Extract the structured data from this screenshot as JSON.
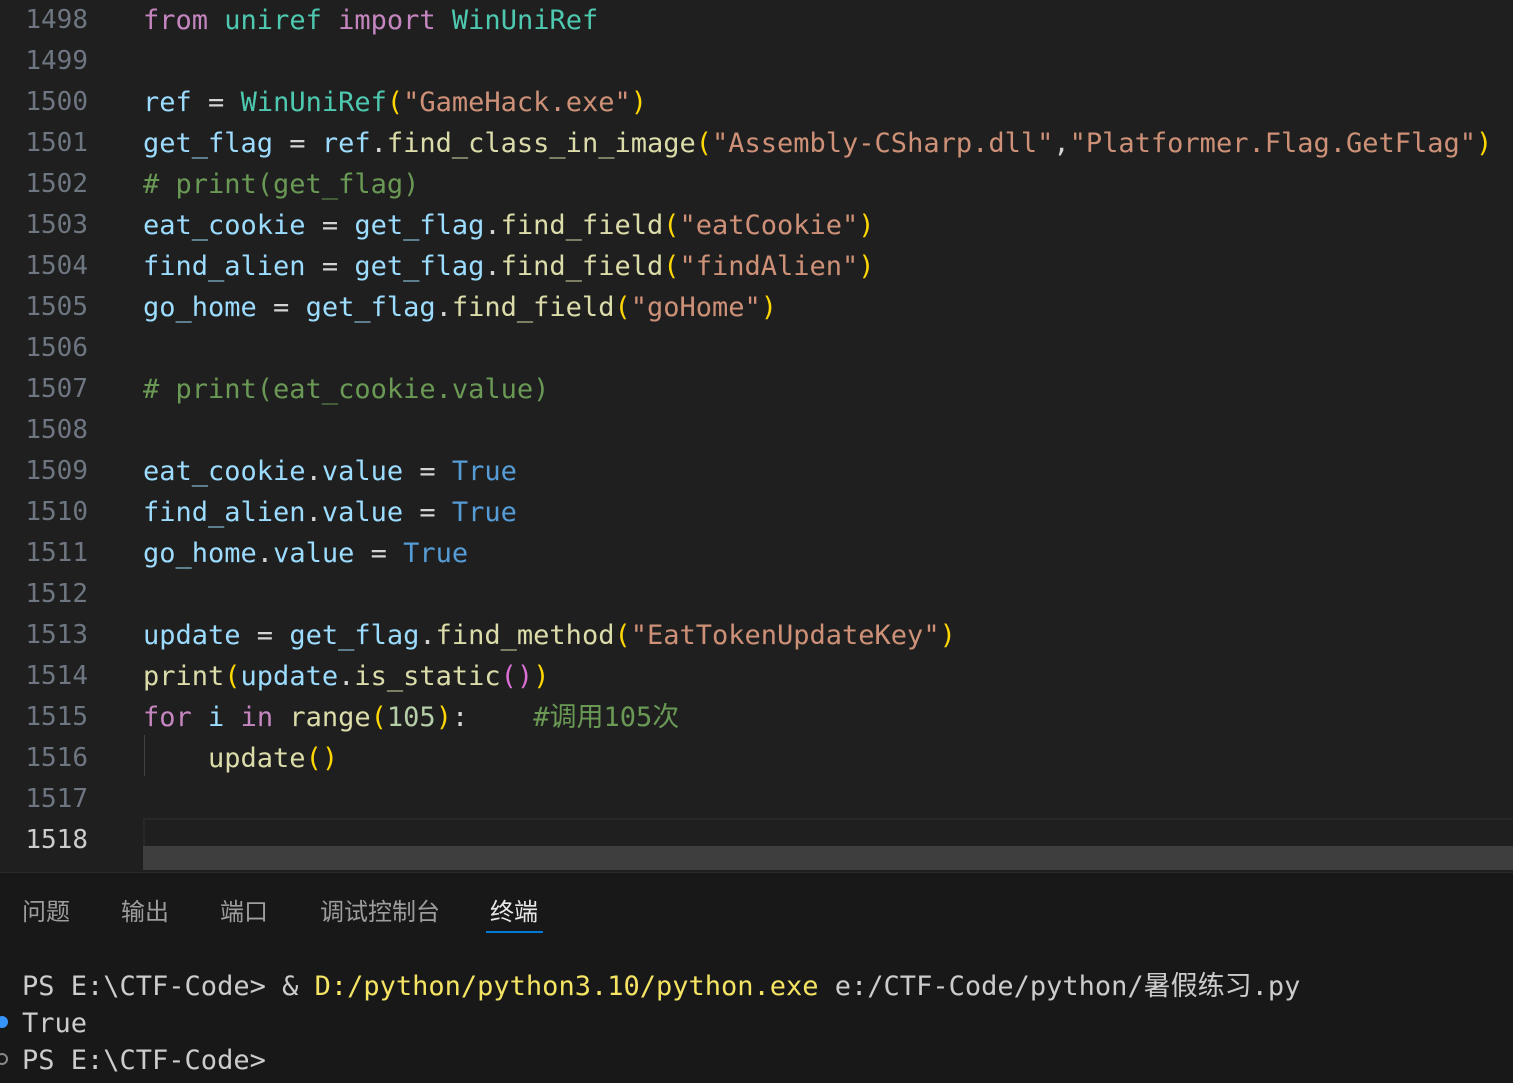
{
  "editor": {
    "lines": [
      {
        "n": "1498",
        "tokens": [
          [
            "kw",
            "from"
          ],
          [
            "op",
            " "
          ],
          [
            "cls",
            "uniref"
          ],
          [
            "op",
            " "
          ],
          [
            "kw",
            "import"
          ],
          [
            "op",
            " "
          ],
          [
            "cls",
            "WinUniRef"
          ]
        ]
      },
      {
        "n": "1499",
        "tokens": []
      },
      {
        "n": "1500",
        "tokens": [
          [
            "var",
            "ref"
          ],
          [
            "op",
            " = "
          ],
          [
            "cls",
            "WinUniRef"
          ],
          [
            "b1",
            "("
          ],
          [
            "str",
            "\"GameHack.exe\""
          ],
          [
            "b1",
            ")"
          ]
        ]
      },
      {
        "n": "1501",
        "tokens": [
          [
            "var",
            "get_flag"
          ],
          [
            "op",
            " = "
          ],
          [
            "var",
            "ref"
          ],
          [
            "op",
            "."
          ],
          [
            "fn",
            "find_class_in_image"
          ],
          [
            "b1",
            "("
          ],
          [
            "str",
            "\"Assembly-CSharp.dll\""
          ],
          [
            "op",
            ","
          ],
          [
            "str",
            "\"Platformer.Flag.GetFlag\""
          ],
          [
            "b1",
            ")"
          ]
        ]
      },
      {
        "n": "1502",
        "tokens": [
          [
            "cmt",
            "# print(get_flag)"
          ]
        ]
      },
      {
        "n": "1503",
        "tokens": [
          [
            "var",
            "eat_cookie"
          ],
          [
            "op",
            " = "
          ],
          [
            "var",
            "get_flag"
          ],
          [
            "op",
            "."
          ],
          [
            "fn",
            "find_field"
          ],
          [
            "b1",
            "("
          ],
          [
            "str",
            "\"eatCookie\""
          ],
          [
            "b1",
            ")"
          ]
        ]
      },
      {
        "n": "1504",
        "tokens": [
          [
            "var",
            "find_alien"
          ],
          [
            "op",
            " = "
          ],
          [
            "var",
            "get_flag"
          ],
          [
            "op",
            "."
          ],
          [
            "fn",
            "find_field"
          ],
          [
            "b1",
            "("
          ],
          [
            "str",
            "\"findAlien\""
          ],
          [
            "b1",
            ")"
          ]
        ]
      },
      {
        "n": "1505",
        "tokens": [
          [
            "var",
            "go_home"
          ],
          [
            "op",
            " = "
          ],
          [
            "var",
            "get_flag"
          ],
          [
            "op",
            "."
          ],
          [
            "fn",
            "find_field"
          ],
          [
            "b1",
            "("
          ],
          [
            "str",
            "\"goHome\""
          ],
          [
            "b1",
            ")"
          ]
        ]
      },
      {
        "n": "1506",
        "tokens": []
      },
      {
        "n": "1507",
        "tokens": [
          [
            "cmt",
            "# print(eat_cookie.value)"
          ]
        ]
      },
      {
        "n": "1508",
        "tokens": []
      },
      {
        "n": "1509",
        "tokens": [
          [
            "var",
            "eat_cookie"
          ],
          [
            "op",
            "."
          ],
          [
            "var",
            "value"
          ],
          [
            "op",
            " = "
          ],
          [
            "const",
            "True"
          ]
        ]
      },
      {
        "n": "1510",
        "tokens": [
          [
            "var",
            "find_alien"
          ],
          [
            "op",
            "."
          ],
          [
            "var",
            "value"
          ],
          [
            "op",
            " = "
          ],
          [
            "const",
            "True"
          ]
        ]
      },
      {
        "n": "1511",
        "tokens": [
          [
            "var",
            "go_home"
          ],
          [
            "op",
            "."
          ],
          [
            "var",
            "value"
          ],
          [
            "op",
            " = "
          ],
          [
            "const",
            "True"
          ]
        ]
      },
      {
        "n": "1512",
        "tokens": []
      },
      {
        "n": "1513",
        "tokens": [
          [
            "var",
            "update"
          ],
          [
            "op",
            " = "
          ],
          [
            "var",
            "get_flag"
          ],
          [
            "op",
            "."
          ],
          [
            "fn",
            "find_method"
          ],
          [
            "b1",
            "("
          ],
          [
            "str",
            "\"EatTokenUpdateKey\""
          ],
          [
            "b1",
            ")"
          ]
        ]
      },
      {
        "n": "1514",
        "tokens": [
          [
            "fn",
            "print"
          ],
          [
            "b1",
            "("
          ],
          [
            "var",
            "update"
          ],
          [
            "op",
            "."
          ],
          [
            "fn",
            "is_static"
          ],
          [
            "b2",
            "()"
          ],
          [
            "b1",
            ")"
          ]
        ]
      },
      {
        "n": "1515",
        "tokens": [
          [
            "kw",
            "for"
          ],
          [
            "op",
            " "
          ],
          [
            "var",
            "i"
          ],
          [
            "op",
            " "
          ],
          [
            "kw",
            "in"
          ],
          [
            "op",
            " "
          ],
          [
            "fn",
            "range"
          ],
          [
            "b1",
            "("
          ],
          [
            "num",
            "105"
          ],
          [
            "b1",
            ")"
          ],
          [
            "op",
            ":    "
          ],
          [
            "cmt",
            "#调用105次"
          ]
        ]
      },
      {
        "n": "1516",
        "tokens": [
          [
            "op",
            "    "
          ],
          [
            "fn",
            "update"
          ],
          [
            "b1",
            "()"
          ]
        ]
      },
      {
        "n": "1517",
        "tokens": []
      },
      {
        "n": "1518",
        "tokens": [],
        "active": true
      }
    ]
  },
  "panel": {
    "tabs": [
      {
        "label": "问题",
        "active": false
      },
      {
        "label": "输出",
        "active": false
      },
      {
        "label": "端口",
        "active": false
      },
      {
        "label": "调试控制台",
        "active": false
      },
      {
        "label": "终端",
        "active": true
      }
    ],
    "terminal": {
      "line1_prompt": "PS E:\\CTF-Code> & ",
      "line1_exe": "D:/python/python3.10/python.exe",
      "line1_script": " e:/CTF-Code/python/暑假练习.py",
      "line2": "True",
      "line3": "PS E:\\CTF-Code>"
    }
  },
  "colors": {
    "editor_bg": "#1f1f1f",
    "panel_bg": "#181818",
    "accent": "#0078d4",
    "keyword": "#c586c0",
    "class": "#4ec9b0",
    "function": "#dcdcaa",
    "variable": "#9cdcfe",
    "string": "#ce9178",
    "constant": "#569cd6",
    "comment": "#6a9955"
  }
}
